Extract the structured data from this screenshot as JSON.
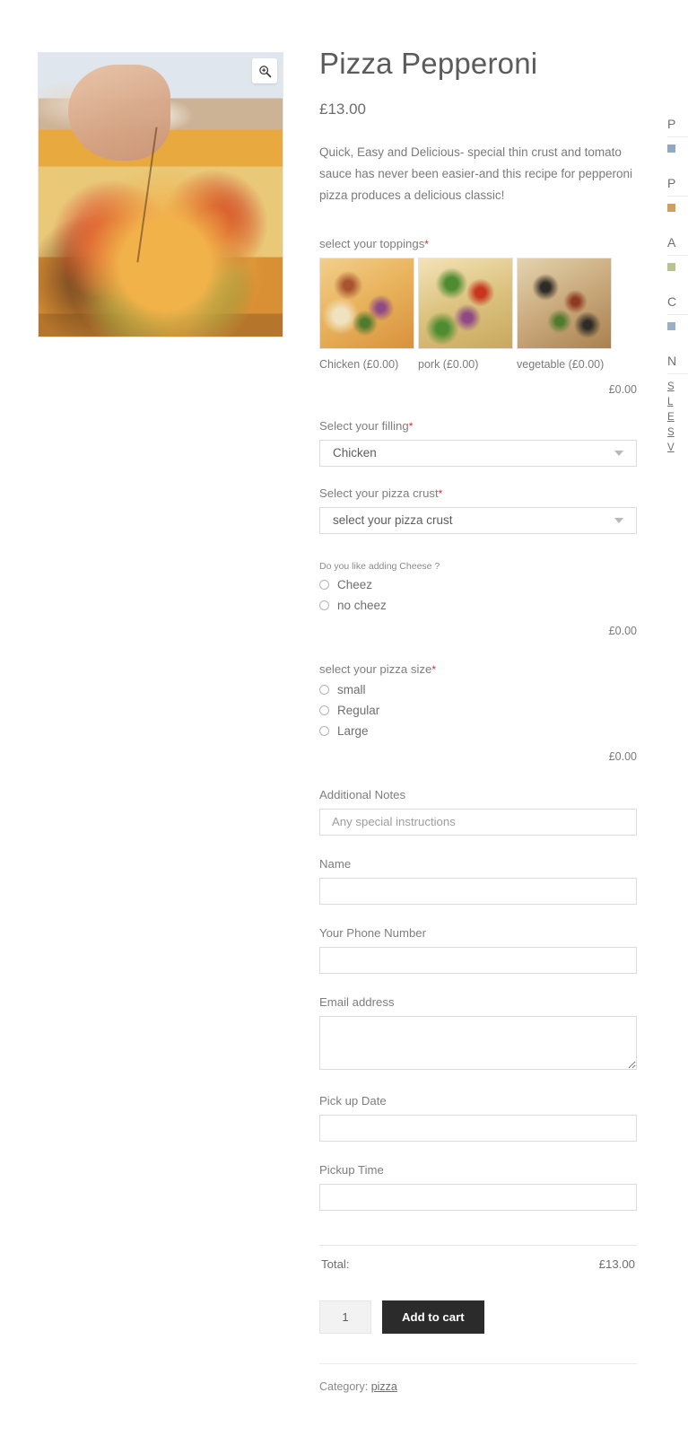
{
  "gallery": {
    "zoom_icon": "magnifier-plus-icon",
    "image_alt": "pepperoni pizza in box with hand taking a slice"
  },
  "product": {
    "title": "Pizza Pepperoni",
    "price": "£13.00",
    "description": "Quick, Easy and Delicious- special thin crust and tomato sauce has never been easier-and this recipe for pepperoni pizza produces a delicious classic!",
    "category_label": "Category:",
    "category_value": "pizza"
  },
  "toppings": {
    "label": "select your toppings",
    "required_mark": "*",
    "options": [
      {
        "label": "Chicken (£0.00)"
      },
      {
        "label": "pork (£0.00)"
      },
      {
        "label": "vegetable (£0.00)"
      }
    ],
    "addon_total": "£0.00"
  },
  "filling": {
    "label": "Select your filling",
    "required_mark": "*",
    "value": "Chicken",
    "arrow_icon": "chevron-down-icon"
  },
  "crust": {
    "label": "Select your pizza crust",
    "required_mark": "*",
    "value": "select your pizza crust",
    "arrow_icon": "chevron-down-icon"
  },
  "cheese": {
    "label": "Do you like adding Cheese ?",
    "options": [
      {
        "label": "Cheez"
      },
      {
        "label": "no cheez"
      }
    ],
    "addon_total": "£0.00"
  },
  "size": {
    "label": "select your pizza size",
    "required_mark": "*",
    "options": [
      {
        "label": "small"
      },
      {
        "label": "Regular"
      },
      {
        "label": "Large"
      }
    ],
    "addon_total": "£0.00"
  },
  "fields": {
    "notes_label": "Additional Notes",
    "notes_placeholder": "Any special instructions",
    "notes_value": "",
    "name_label": "Name",
    "name_value": "",
    "phone_label": "Your Phone Number",
    "phone_value": "",
    "email_label": "Email address",
    "email_value": "",
    "pickup_date_label": "Pick up Date",
    "pickup_date_value": "",
    "pickup_time_label": "Pickup Time",
    "pickup_time_value": ""
  },
  "cart": {
    "total_label": "Total:",
    "total_value": "£13.00",
    "quantity": "1",
    "add_to_cart_label": "Add to cart"
  },
  "sidebar": {
    "blocks": [
      {
        "heading": "P",
        "items": [
          {
            "text": ""
          }
        ]
      },
      {
        "heading": "P",
        "items": [
          {
            "text": ""
          }
        ]
      },
      {
        "heading": "A",
        "items": [
          {
            "text": ""
          }
        ]
      },
      {
        "heading": "C",
        "items": [
          {
            "text": ""
          }
        ]
      }
    ],
    "links_heading": "N",
    "links": [
      "S",
      "L",
      "E",
      "S",
      "V"
    ]
  },
  "colors": {
    "accent_required": "#e02b2b",
    "button_dark": "#2b2b2b",
    "text_muted": "#7a7a7a",
    "border": "#dcdcdc"
  }
}
